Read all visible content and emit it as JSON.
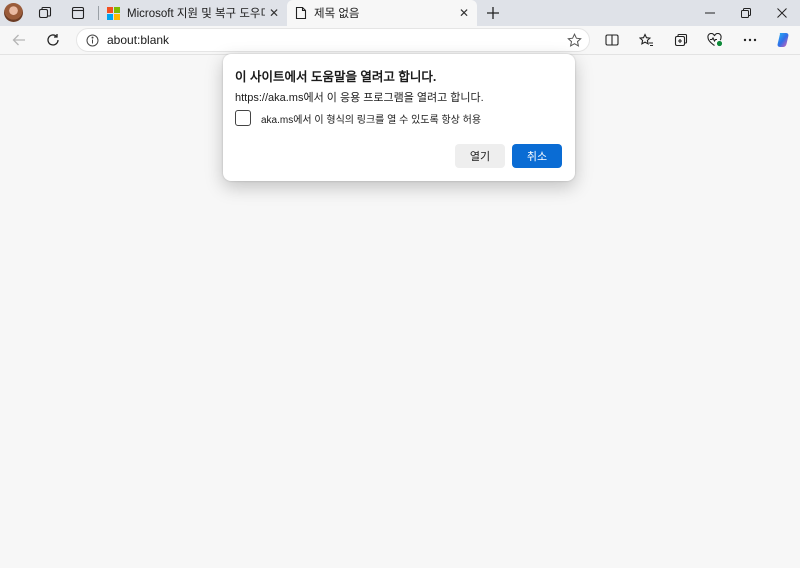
{
  "tabs": [
    {
      "title": "Microsoft 지원 및 복구 도우미 - M",
      "icon": "microsoft-logo-icon"
    },
    {
      "title": "제목 없음",
      "icon": "blank-page-icon"
    }
  ],
  "address": {
    "url": "about:blank"
  },
  "dialog": {
    "title": "이 사이트에서 도움말을 열려고 합니다.",
    "message": "https://aka.ms에서 이 응용 프로그램을 열려고 합니다.",
    "checkbox_label": "aka.ms에서 이 형식의 링크를 열 수 있도록 항상 허용",
    "checkbox_checked": false,
    "open_label": "열기",
    "cancel_label": "취소"
  },
  "colors": {
    "accent": "#0a6cd4",
    "tabstrip": "#dfe2e8",
    "page": "#f7f7f7"
  }
}
